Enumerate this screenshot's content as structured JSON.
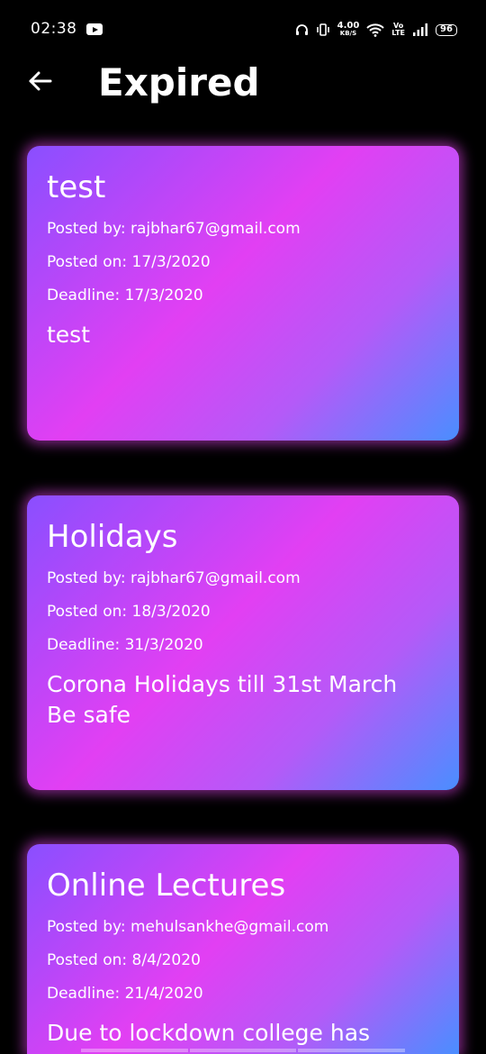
{
  "status_bar": {
    "time": "02:38",
    "speed_value": "4.00",
    "speed_unit": "KB/S",
    "volte_top": "Vo",
    "volte_bottom": "LTE",
    "battery": "96"
  },
  "header": {
    "title": "Expired"
  },
  "cards": [
    {
      "title": "test",
      "posted_by": "Posted by: rajbhar67@gmail.com",
      "posted_on": "Posted on: 17/3/2020",
      "deadline": "Deadline: 17/3/2020",
      "body": "test"
    },
    {
      "title": "Holidays",
      "posted_by": "Posted by: rajbhar67@gmail.com",
      "posted_on": "Posted on: 18/3/2020",
      "deadline": "Deadline: 31/3/2020",
      "body": "Corona Holidays till 31st March\nBe safe"
    },
    {
      "title": "Online Lectures",
      "posted_by": "Posted by: mehulsankhe@gmail.com",
      "posted_on": "Posted on: 8/4/2020",
      "deadline": "Deadline: 21/4/2020",
      "body": "Due to lockdown college has"
    }
  ],
  "icons": {
    "back": "arrow-left-icon",
    "youtube": "youtube-icon",
    "headphone": "headphone-icon",
    "vibrate": "vibrate-icon",
    "wifi": "wifi-icon",
    "signal": "signal-icon",
    "battery": "battery-icon"
  },
  "colors": {
    "background": "#000000",
    "gradient_start": "#8a4fff",
    "gradient_mid": "#e23ff3",
    "gradient_end": "#4a8eff",
    "text": "#ffffff"
  }
}
